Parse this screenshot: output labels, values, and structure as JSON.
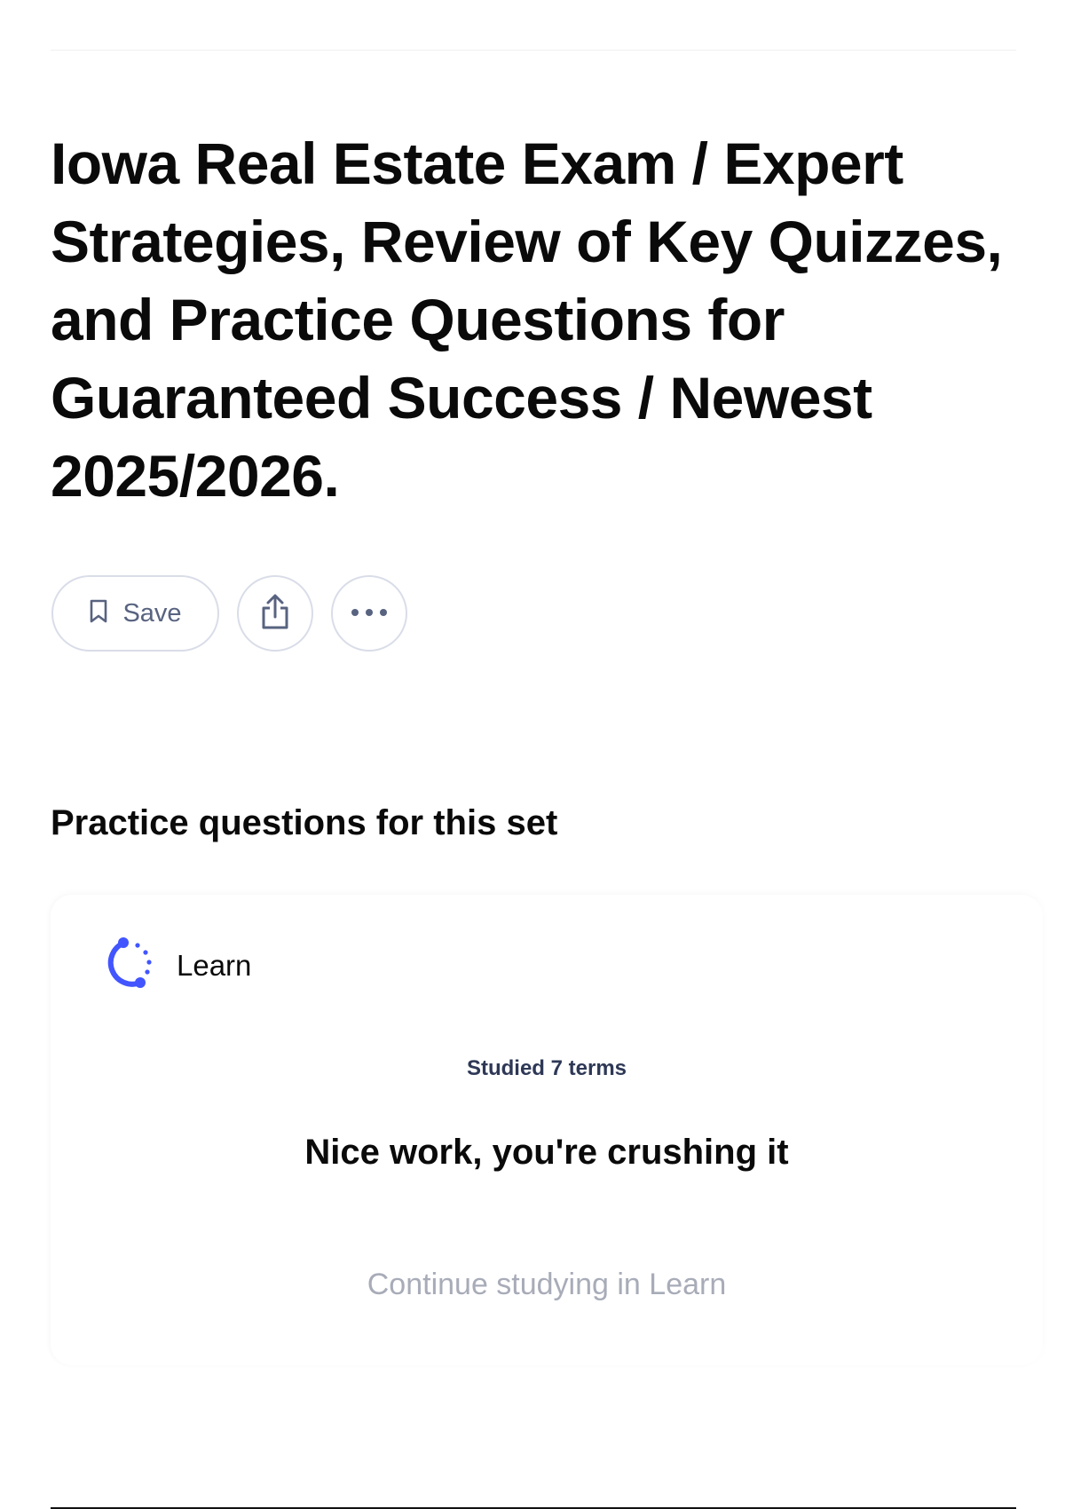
{
  "header": {
    "title": "Iowa Real Estate Exam / Expert Strategies, Review of Key Quizzes, and Practice Questions for Guaranteed Success / Newest 2025/2026."
  },
  "actions": {
    "save_label": "Save",
    "save_icon": "bookmark-icon",
    "share_icon": "share-icon",
    "more_icon": "more-options-icon"
  },
  "practice": {
    "heading": "Practice questions for this set",
    "learn": {
      "label": "Learn",
      "icon": "learn-progress-icon",
      "studied_text": "Studied 7 terms",
      "message": "Nice work, you're crushing it",
      "continue_label": "Continue studying in Learn"
    }
  },
  "colors": {
    "accent": "#4255ff",
    "muted_text": "#586380",
    "disabled_text": "#a8acb8",
    "border": "#d9dde8"
  }
}
